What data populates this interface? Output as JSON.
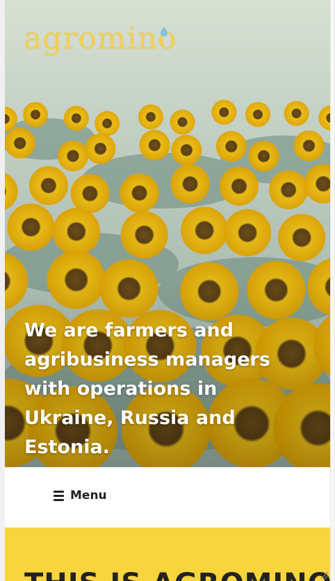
{
  "brand": {
    "logo_text": "agromino"
  },
  "hero": {
    "tagline": "We are farmers and agribusiness managers with operations in Ukraine, Russia and Estonia."
  },
  "nav": {
    "menu_label": "Menu",
    "menu_icon": "hamburger-icon"
  },
  "section": {
    "heading": "THIS IS AGROMINO"
  },
  "colors": {
    "accent": "#f9d53d",
    "logo": "#f3cf55",
    "text": "#222222",
    "white": "#ffffff"
  }
}
